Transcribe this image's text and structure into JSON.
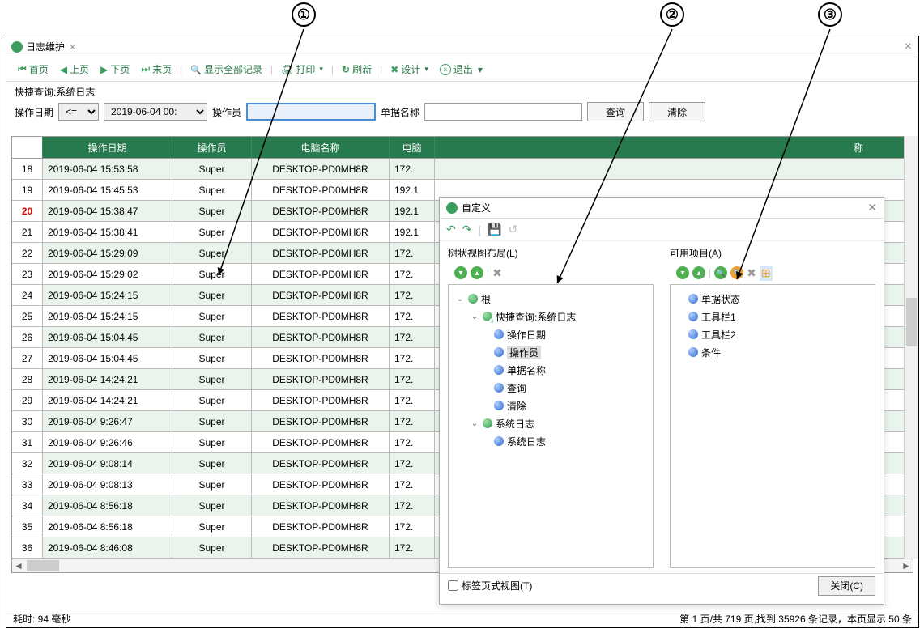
{
  "callouts": [
    "①",
    "②",
    "③"
  ],
  "tab": {
    "title": "日志维护",
    "close": "×"
  },
  "toolbar": {
    "first": "首页",
    "prev": "上页",
    "next": "下页",
    "last": "末页",
    "show_all": "显示全部记录",
    "print": "打印",
    "refresh": "刷新",
    "design": "设计",
    "exit": "退出"
  },
  "filter": {
    "title": "快捷查询:系统日志",
    "op_date_label": "操作日期",
    "comparator": "<=",
    "date_value": "2019-06-04 00:",
    "operator_label": "操作员",
    "doc_name_label": "单据名称",
    "query_btn": "查询",
    "clear_btn": "清除"
  },
  "grid": {
    "headers": {
      "date": "操作日期",
      "operator": "操作员",
      "pc": "电脑名称",
      "ip": "电脑",
      "rest": "称"
    },
    "rows": [
      {
        "n": "18",
        "d": "2019-06-04 15:53:58",
        "op": "Super",
        "pc": "DESKTOP-PD0MH8R",
        "ip": "172."
      },
      {
        "n": "19",
        "d": "2019-06-04 15:45:53",
        "op": "Super",
        "pc": "DESKTOP-PD0MH8R",
        "ip": "192.1"
      },
      {
        "n": "20",
        "d": "2019-06-04 15:38:47",
        "op": "Super",
        "pc": "DESKTOP-PD0MH8R",
        "ip": "192.1",
        "red": true
      },
      {
        "n": "21",
        "d": "2019-06-04 15:38:41",
        "op": "Super",
        "pc": "DESKTOP-PD0MH8R",
        "ip": "192.1"
      },
      {
        "n": "22",
        "d": "2019-06-04 15:29:09",
        "op": "Super",
        "pc": "DESKTOP-PD0MH8R",
        "ip": "172."
      },
      {
        "n": "23",
        "d": "2019-06-04 15:29:02",
        "op": "Super",
        "pc": "DESKTOP-PD0MH8R",
        "ip": "172."
      },
      {
        "n": "24",
        "d": "2019-06-04 15:24:15",
        "op": "Super",
        "pc": "DESKTOP-PD0MH8R",
        "ip": "172."
      },
      {
        "n": "25",
        "d": "2019-06-04 15:24:15",
        "op": "Super",
        "pc": "DESKTOP-PD0MH8R",
        "ip": "172."
      },
      {
        "n": "26",
        "d": "2019-06-04 15:04:45",
        "op": "Super",
        "pc": "DESKTOP-PD0MH8R",
        "ip": "172."
      },
      {
        "n": "27",
        "d": "2019-06-04 15:04:45",
        "op": "Super",
        "pc": "DESKTOP-PD0MH8R",
        "ip": "172."
      },
      {
        "n": "28",
        "d": "2019-06-04 14:24:21",
        "op": "Super",
        "pc": "DESKTOP-PD0MH8R",
        "ip": "172."
      },
      {
        "n": "29",
        "d": "2019-06-04 14:24:21",
        "op": "Super",
        "pc": "DESKTOP-PD0MH8R",
        "ip": "172."
      },
      {
        "n": "30",
        "d": "2019-06-04 9:26:47",
        "op": "Super",
        "pc": "DESKTOP-PD0MH8R",
        "ip": "172."
      },
      {
        "n": "31",
        "d": "2019-06-04 9:26:46",
        "op": "Super",
        "pc": "DESKTOP-PD0MH8R",
        "ip": "172."
      },
      {
        "n": "32",
        "d": "2019-06-04 9:08:14",
        "op": "Super",
        "pc": "DESKTOP-PD0MH8R",
        "ip": "172."
      },
      {
        "n": "33",
        "d": "2019-06-04 9:08:13",
        "op": "Super",
        "pc": "DESKTOP-PD0MH8R",
        "ip": "172."
      },
      {
        "n": "34",
        "d": "2019-06-04 8:56:18",
        "op": "Super",
        "pc": "DESKTOP-PD0MH8R",
        "ip": "172."
      },
      {
        "n": "35",
        "d": "2019-06-04 8:56:18",
        "op": "Super",
        "pc": "DESKTOP-PD0MH8R",
        "ip": "172."
      },
      {
        "n": "36",
        "d": "2019-06-04 8:46:08",
        "op": "Super",
        "pc": "DESKTOP-PD0MH8R",
        "ip": "172."
      }
    ]
  },
  "statusbar": {
    "left": "耗时: 94 毫秒",
    "right": "第 1 页/共 719 页,找到 35926 条记录，本页显示 50 条"
  },
  "popup": {
    "title": "自定义",
    "toolbar": {
      "undo": "↶",
      "redo": "↷",
      "save": "💾",
      "revert": "↺"
    },
    "left_panel": {
      "title": "树状视图布局(L)",
      "nodes": {
        "root": "根",
        "quick": "快捷查询:系统日志",
        "op_date": "操作日期",
        "operator": "操作员",
        "doc_name": "单据名称",
        "query": "查询",
        "clear": "清除",
        "syslog": "系统日志",
        "syslog_child": "系统日志"
      }
    },
    "right_panel": {
      "title": "可用项目(A)",
      "items": {
        "doc_status": "单据状态",
        "toolbar1": "工具栏1",
        "toolbar2": "工具栏2",
        "condition": "条件"
      }
    },
    "footer": {
      "tab_view": "标签页式视图(T)",
      "close": "关闭(C)"
    }
  }
}
